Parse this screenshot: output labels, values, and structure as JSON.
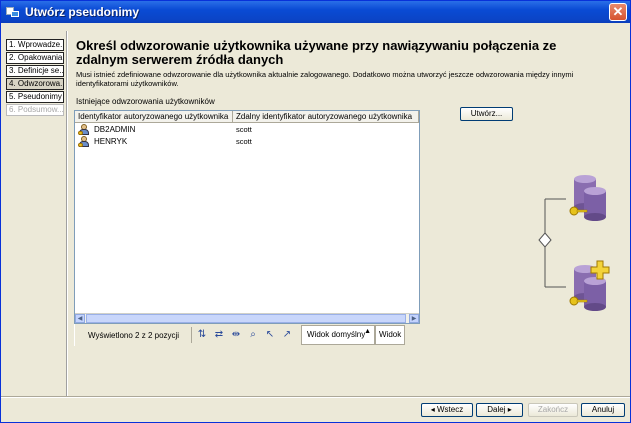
{
  "window": {
    "title": "Utwórz pseudonimy"
  },
  "nav": [
    {
      "label": "1. Wprowadze...",
      "state": "normal"
    },
    {
      "label": "2. Opakowania",
      "state": "normal"
    },
    {
      "label": "3. Definicje se...",
      "state": "normal"
    },
    {
      "label": "4. Odwzorowa...",
      "state": "active"
    },
    {
      "label": "5. Pseudonimy",
      "state": "normal"
    },
    {
      "label": "6. Podsumow...",
      "state": "disabled"
    }
  ],
  "main": {
    "heading": "Określ odwzorowanie użytkownika używane przy nawiązywaniu połączenia ze zdalnym serwerem źródła danych",
    "description": "Musi istnieć zdefiniowane odwzorowanie dla użytkownika aktualnie zalogowanego. Dodatkowo można utworzyć jeszcze odwzorowania między innymi identyfikatorami użytkowników.",
    "existing_label": "Istniejące odwzorowania użytkowników",
    "table": {
      "columns": [
        "Identyfikator autoryzowanego użytkownika",
        "Zdalny identyfikator autoryzowanego użytkownika"
      ],
      "rows": [
        {
          "user": "DB2ADMIN",
          "remote": "scott"
        },
        {
          "user": "HENRYK",
          "remote": "scott"
        }
      ]
    },
    "toolbar": {
      "count_label": "Wyświetlono 2 z 2 pozycji",
      "view_label": "Widok domyślny",
      "view_label2": "Widok"
    },
    "create_button": "Utwórz..."
  },
  "footer": {
    "back": "◂ Wstecz",
    "next": "Dalej ▸",
    "finish": "Zakończ",
    "cancel": "Anuluj"
  },
  "colors": {
    "title_bar": "#0a4bd4",
    "window_bg": "#ece9d8",
    "db_purple": "#8a6db0"
  }
}
